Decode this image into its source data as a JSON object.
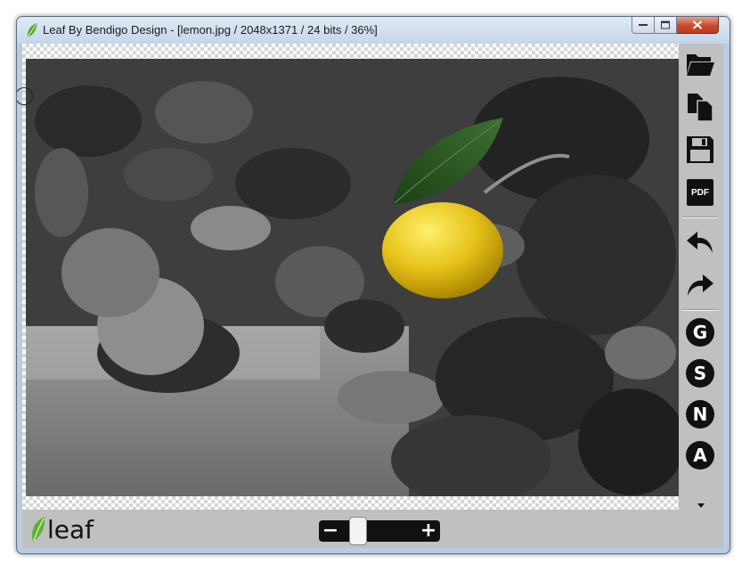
{
  "window": {
    "title": "Leaf By Bendigo Design - [lemon.jpg / 2048x1371 / 24 bits / 36%]",
    "controls": [
      "minimize",
      "maximize",
      "close"
    ]
  },
  "toolbar": {
    "tools": [
      {
        "name": "open-folder",
        "icon": "folder-open-icon"
      },
      {
        "name": "copy",
        "icon": "copy-icon"
      },
      {
        "name": "save",
        "icon": "floppy-disk-icon"
      },
      {
        "name": "pdf",
        "icon": "pdf-icon",
        "label": "PDF"
      },
      {
        "name": "undo",
        "icon": "undo-arrow-icon"
      },
      {
        "name": "redo",
        "icon": "redo-arrow-icon"
      },
      {
        "name": "g",
        "label": "G"
      },
      {
        "name": "s",
        "label": "S"
      },
      {
        "name": "n",
        "label": "N"
      },
      {
        "name": "a",
        "label": "A"
      }
    ]
  },
  "logo": {
    "text": "leaf"
  },
  "zoom": {
    "minus": "−",
    "plus": "+",
    "level": 0.16
  },
  "colors": {
    "window_frame": "#b9cde2",
    "panel": "#c0c0c0",
    "lemon": "#e6c21a",
    "leaf": "#2e5a22",
    "logo_green": "#5fb12e"
  }
}
